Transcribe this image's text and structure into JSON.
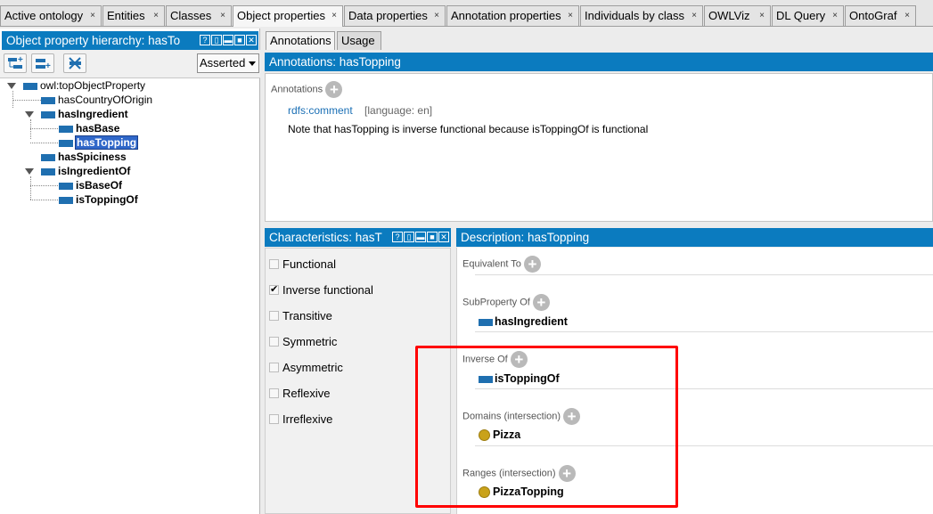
{
  "tabs": [
    {
      "label": "Active ontology"
    },
    {
      "label": "Entities"
    },
    {
      "label": "Classes"
    },
    {
      "label": "Object properties"
    },
    {
      "label": "Data properties"
    },
    {
      "label": "Annotation properties"
    },
    {
      "label": "Individuals by class"
    },
    {
      "label": "OWLViz"
    },
    {
      "label": "DL Query"
    },
    {
      "label": "OntoGraf"
    }
  ],
  "tab_close_glyph": "×",
  "hierarchy": {
    "title": "Object property hierarchy: hasTo",
    "reasoner_mode": "Asserted",
    "items": [
      {
        "label": "owl:topObjectProperty"
      },
      {
        "label": "hasCountryOfOrigin"
      },
      {
        "label": "hasIngredient"
      },
      {
        "label": "hasBase"
      },
      {
        "label": "hasTopping"
      },
      {
        "label": "hasSpiciness"
      },
      {
        "label": "isIngredientOf"
      },
      {
        "label": "isBaseOf"
      },
      {
        "label": "isToppingOf"
      }
    ]
  },
  "subtabs": [
    {
      "label": "Annotations"
    },
    {
      "label": "Usage"
    }
  ],
  "annotations": {
    "title": "Annotations: hasTopping",
    "section_label": "Annotations",
    "property": "rdfs:comment",
    "language": "[language: en]",
    "text": "Note that hasTopping is inverse functional because isToppingOf is functional"
  },
  "characteristics": {
    "title": "Characteristics: hasT",
    "items": [
      {
        "label": "Functional",
        "checked": false
      },
      {
        "label": "Inverse functional",
        "checked": true
      },
      {
        "label": "Transitive",
        "checked": false
      },
      {
        "label": "Symmetric",
        "checked": false
      },
      {
        "label": "Asymmetric",
        "checked": false
      },
      {
        "label": "Reflexive",
        "checked": false
      },
      {
        "label": "Irreflexive",
        "checked": false
      }
    ]
  },
  "description": {
    "title": "Description: hasTopping",
    "equivalent_to": "Equivalent To",
    "subproperty_of": "SubProperty Of",
    "subproperty_value": "hasIngredient",
    "inverse_of": "Inverse Of",
    "inverse_value": "isToppingOf",
    "domains": "Domains (intersection)",
    "domain_value": "Pizza",
    "ranges": "Ranges (intersection)",
    "range_value": "PizzaTopping"
  },
  "colors": {
    "header_blue": "#0b7bbf",
    "property_blue": "#1f6fb0",
    "class_gold": "#c9a21a",
    "highlight_red": "#ff0000"
  }
}
